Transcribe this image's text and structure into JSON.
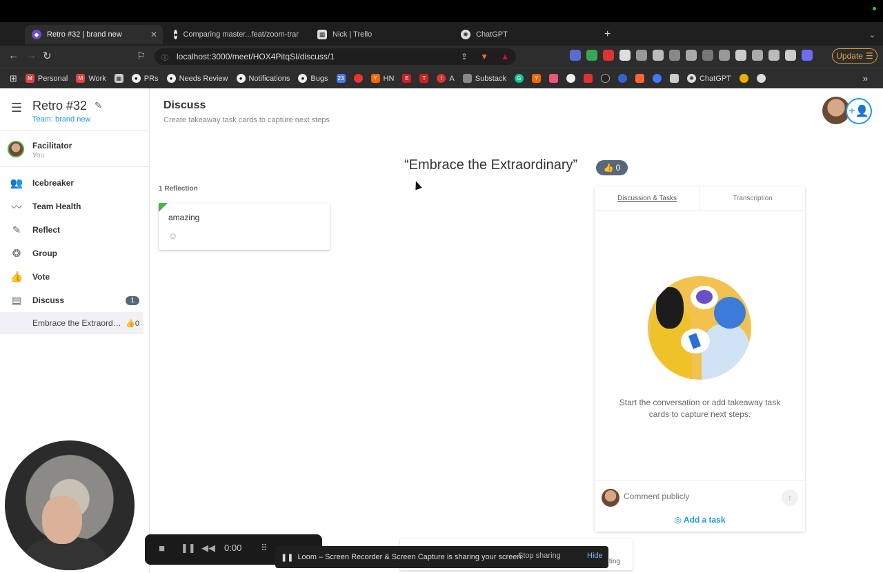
{
  "browser": {
    "tabs": [
      {
        "title": "Retro #32 | brand new",
        "active": true
      },
      {
        "title": "Comparing master...feat/zoom-trar",
        "active": false
      },
      {
        "title": "Nick | Trello",
        "active": false
      },
      {
        "title": "ChatGPT",
        "active": false
      }
    ],
    "url": "localhost:3000/meet/HOX4PitqSI/discuss/1",
    "update_label": "Update",
    "bookmarks": [
      "Personal",
      "Work",
      "PRs",
      "Needs Review",
      "Notifications",
      "Bugs",
      "HN",
      "A",
      "Substack",
      "ChatGPT"
    ]
  },
  "sidebar": {
    "retro_title": "Retro #32",
    "team_label": "Team: brand new",
    "facilitator_label": "Facilitator",
    "facilitator_name": "You",
    "items": [
      {
        "label": "Icebreaker",
        "icon": "people-icon"
      },
      {
        "label": "Team Health",
        "icon": "pulse-icon"
      },
      {
        "label": "Reflect",
        "icon": "pencil-icon"
      },
      {
        "label": "Group",
        "icon": "group-icon"
      },
      {
        "label": "Vote",
        "icon": "thumbs-icon"
      },
      {
        "label": "Discuss",
        "icon": "chat-icon",
        "badge": "1"
      }
    ],
    "sub_item": {
      "label": "Embrace the Extraordinary",
      "votes": "0"
    }
  },
  "main": {
    "title": "Discuss",
    "subtitle": "Create takeaway task cards to capture next steps",
    "topic": "“Embrace the Extraordinary”",
    "topic_votes": "0",
    "reflection_count": "1 Reflection",
    "card_text": "amazing"
  },
  "panel": {
    "tabs": [
      "Discussion & Tasks",
      "Transcription"
    ],
    "message": "Start the conversation or add takeaway task cards to capture next steps.",
    "comment_placeholder": "Comment publicly",
    "add_task_label": "Add a task"
  },
  "loom": {
    "time": "0:00",
    "share_text": "Loom – Screen Recorder & Screen Capture is sharing your screen.",
    "stop_label": "Stop sharing",
    "hide_label": "Hide",
    "card_fragment": "ting"
  },
  "colors": {
    "accent": "#2196f3",
    "badge": "#58687a",
    "reflection_green": "#4caf50"
  }
}
